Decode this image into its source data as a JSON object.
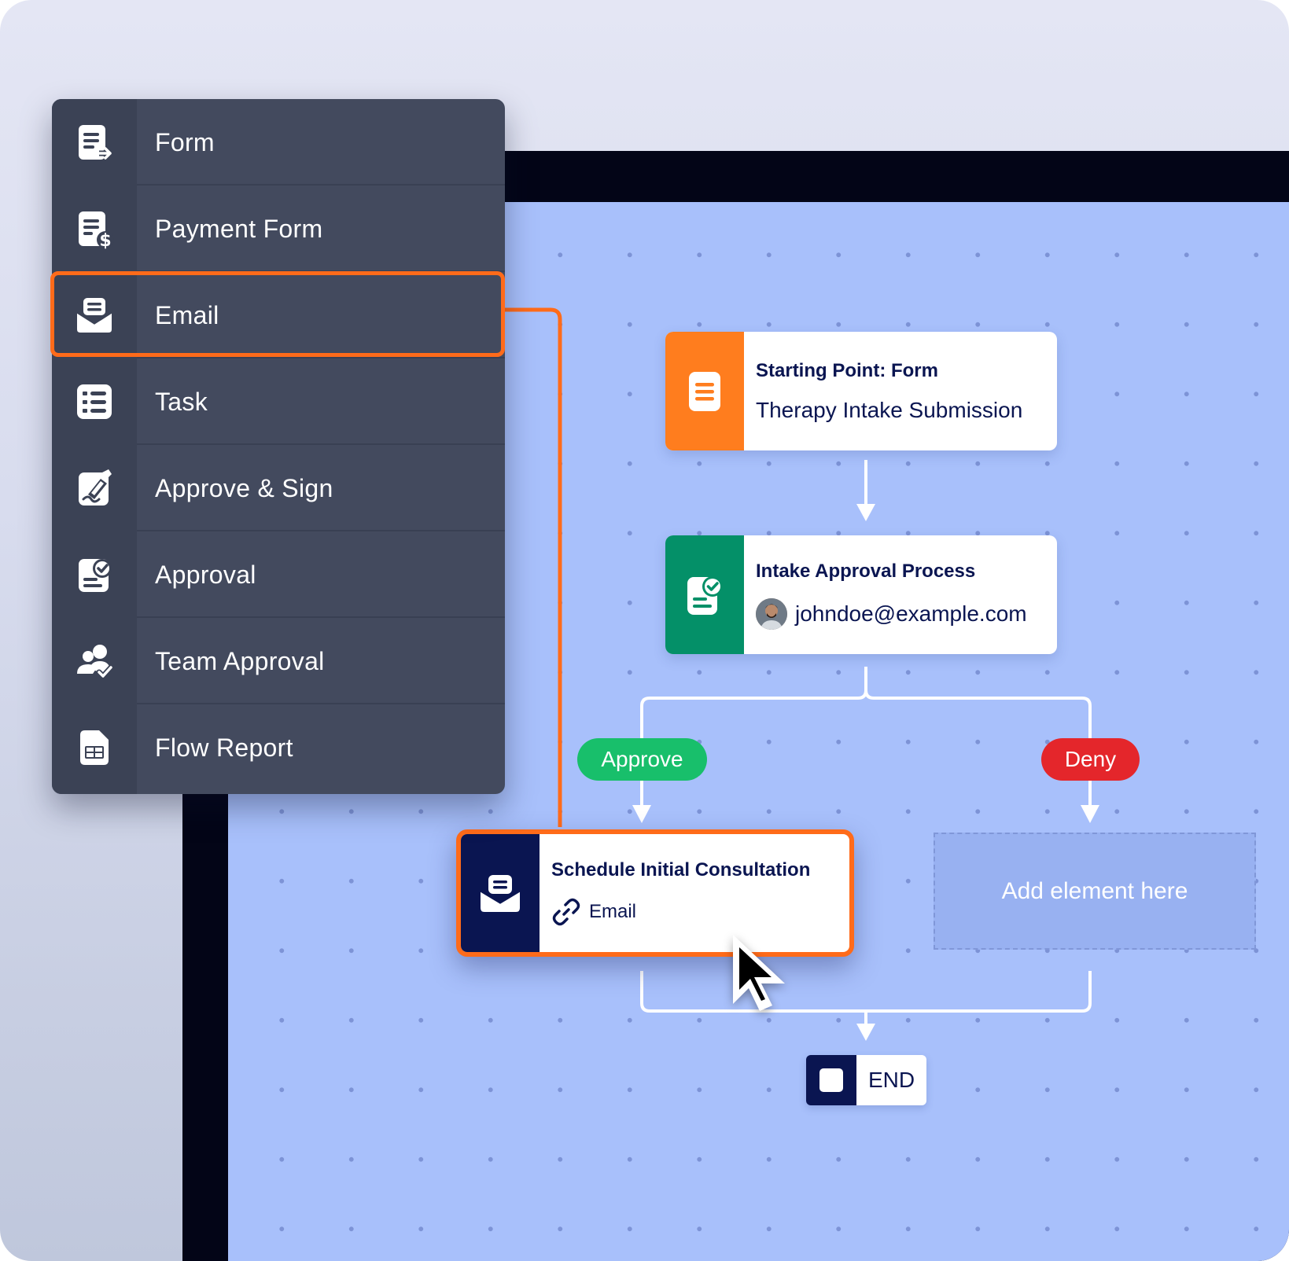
{
  "menu": {
    "items": [
      {
        "label": "Form",
        "icon": "form-icon"
      },
      {
        "label": "Payment Form",
        "icon": "payment-form-icon"
      },
      {
        "label": "Email",
        "icon": "email-icon",
        "selected": true
      },
      {
        "label": "Task",
        "icon": "task-list-icon"
      },
      {
        "label": "Approve & Sign",
        "icon": "sign-pen-icon"
      },
      {
        "label": "Approval",
        "icon": "approval-check-icon"
      },
      {
        "label": "Team Approval",
        "icon": "team-approval-icon"
      },
      {
        "label": "Flow Report",
        "icon": "report-table-icon"
      }
    ]
  },
  "flow": {
    "start_node": {
      "title": "Starting Point: Form",
      "subtitle": "Therapy Intake Submission",
      "icon": "form-icon"
    },
    "approval_node": {
      "title": "Intake Approval Process",
      "assignee": "johndoe@example.com",
      "icon": "approval-check-icon"
    },
    "branches": {
      "approve_label": "Approve",
      "deny_label": "Deny"
    },
    "email_node": {
      "title": "Schedule Initial Consultation",
      "subtitle": "Email",
      "icon": "email-icon"
    },
    "placeholder": {
      "label": "Add element here"
    },
    "end_node": {
      "label": "END"
    }
  },
  "colors": {
    "accent_orange": "#ff6b1a",
    "form_orange": "#ff7d1e",
    "approval_green": "#049068",
    "navy": "#0a1551",
    "approve_green": "#18bf6b",
    "deny_red": "#e4262b",
    "canvas_blue": "#a8c0fb",
    "menu_bg": "#434a5e"
  }
}
